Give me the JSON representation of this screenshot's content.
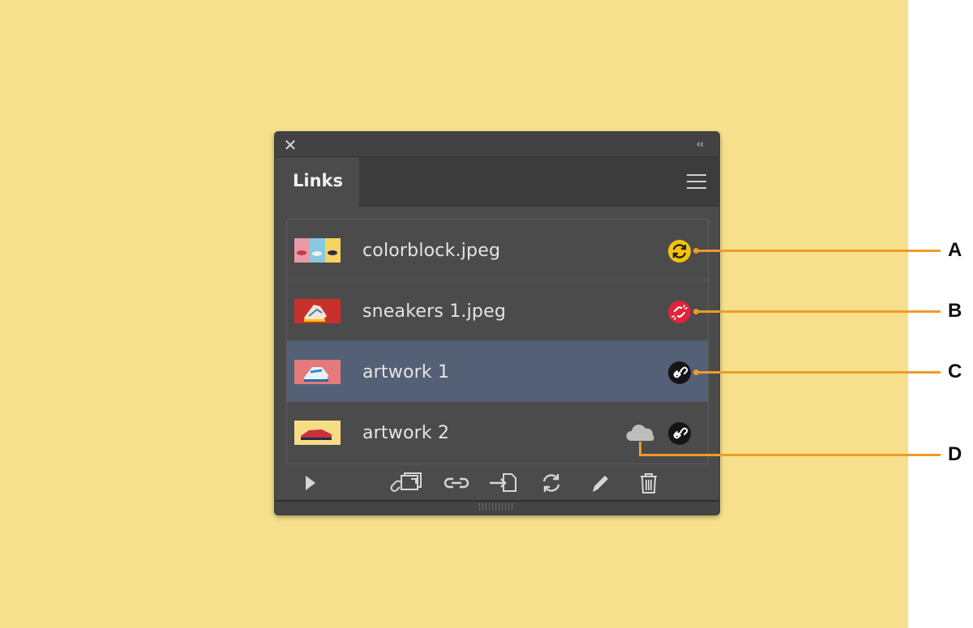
{
  "colors": {
    "background": "#f6e08b",
    "callout": "#ef9a2a",
    "selected_row": "#536075",
    "status_update": "#f4c20d",
    "status_missing": "#e0243c"
  },
  "panel": {
    "close_label": "✕",
    "collapse_label": "‹‹",
    "tab_title": "Links",
    "menu_icon": "hamburger-menu-icon"
  },
  "links": [
    {
      "name": "colorblock.jpeg",
      "status": "modified",
      "status_icon": "update-needed-icon",
      "thumb": "colorblock"
    },
    {
      "name": "sneakers 1.jpeg",
      "status": "missing",
      "status_icon": "missing-link-icon",
      "thumb": "sneakers"
    },
    {
      "name": "artwork 1",
      "status": "linked",
      "status_icon": "library-link-icon",
      "thumb": "artwork1",
      "selected": true
    },
    {
      "name": "artwork 2",
      "status": "linked",
      "status_icon": "library-link-icon",
      "cloud_icon": "cloud-icon",
      "thumb": "artwork2"
    }
  ],
  "footer_tools": [
    "show-link-info-icon",
    "relink-from-cc-libraries-icon",
    "relink-icon",
    "go-to-link-icon",
    "update-link-icon",
    "edit-original-icon",
    "delete-icon"
  ],
  "callouts": [
    {
      "label": "A",
      "target": "colorblock-status"
    },
    {
      "label": "B",
      "target": "sneakers-status"
    },
    {
      "label": "C",
      "target": "artwork1-status"
    },
    {
      "label": "D",
      "target": "artwork2-cloud"
    }
  ]
}
